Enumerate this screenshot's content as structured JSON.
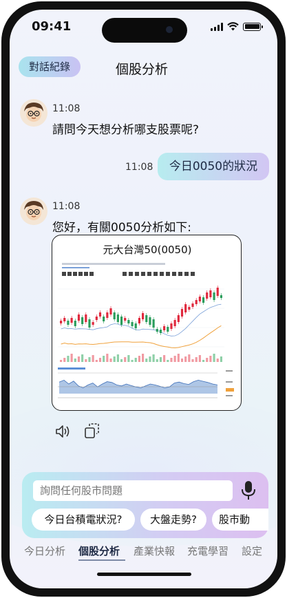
{
  "status_bar": {
    "time": "09:41",
    "battery_level": 1.0
  },
  "header": {
    "history_button": "對話紀錄",
    "title": "個股分析"
  },
  "messages": [
    {
      "sender": "bot",
      "time": "11:08",
      "text": "請問今天想分析哪支股票呢?"
    },
    {
      "sender": "user",
      "time": "11:08",
      "text": "今日0050的狀況"
    },
    {
      "sender": "bot",
      "time": "11:08",
      "text": "您好，有關0050分析如下:",
      "chart_title": "元大台灣50(0050)"
    }
  ],
  "input": {
    "placeholder": "詢問任何股市問題"
  },
  "suggestions": [
    "今日台積電狀況?",
    "大盤走勢?",
    "股市動"
  ],
  "tabs": [
    "今日分析",
    "個股分析",
    "產業快報",
    "充電學習",
    "設定"
  ],
  "active_tab": "個股分析",
  "colors": {
    "accent_start": "#b7ecef",
    "accent_end": "#d2c6f3",
    "candle_up": "#e0293d",
    "candle_down": "#2a9d5c",
    "ma_line": "#f0a13b"
  },
  "icons": {
    "speaker": "speaker-icon",
    "copy": "copy-icon",
    "mic": "microphone-icon"
  }
}
